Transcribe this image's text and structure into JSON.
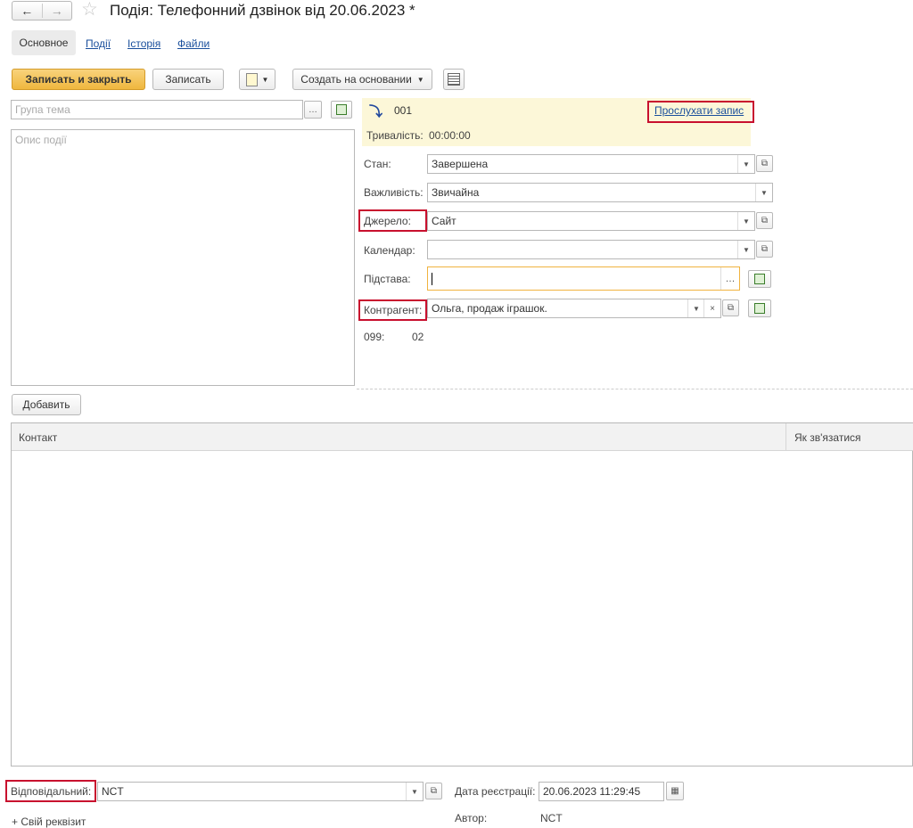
{
  "window": {
    "title": "Подія: Телефонний дзвінок від 20.06.2023 *"
  },
  "tabs": [
    {
      "label": "Основное"
    },
    {
      "label": "Події"
    },
    {
      "label": "Історія"
    },
    {
      "label": "Файли"
    }
  ],
  "toolbar": {
    "save_close": "Записать и закрыть",
    "save": "Записать",
    "create_based": "Создать на основании"
  },
  "subject": {
    "placeholder": "Група тема"
  },
  "description": {
    "placeholder": "Опис події"
  },
  "call": {
    "number": "001",
    "listen": "Прослухати запис",
    "duration_label": "Тривалість:",
    "duration": "00:00:00"
  },
  "form": {
    "state_label": "Стан:",
    "state_value": "Завершена",
    "importance_label": "Важливість:",
    "importance_value": "Звичайна",
    "source_label": "Джерело:",
    "source_value": "Сайт",
    "calendar_label": "Календар:",
    "calendar_value": "",
    "basis_label": "Підстава:",
    "basis_value": "",
    "counterparty_label": "Контрагент:",
    "counterparty_value": "Ольга, продаж іграшок.",
    "phone_a": "099:",
    "phone_b": "02"
  },
  "contacts": {
    "add_button": "Добавить",
    "col_contact": "Контакт",
    "col_how": "Як зв'язатися"
  },
  "footer": {
    "responsible_label": "Відповідальний:",
    "responsible_value": "NCT",
    "reg_date_label": "Дата реєстрації:",
    "reg_date_value": "20.06.2023 11:29:45",
    "author_label": "Автор:",
    "author_value": "NCT",
    "own_attr": "+ Свій реквізит"
  },
  "colors": {
    "primary_button": "#f4c052",
    "highlight_bg": "#fcf7d8",
    "annotation_red": "#c8102e",
    "link": "#1a4f9c"
  }
}
